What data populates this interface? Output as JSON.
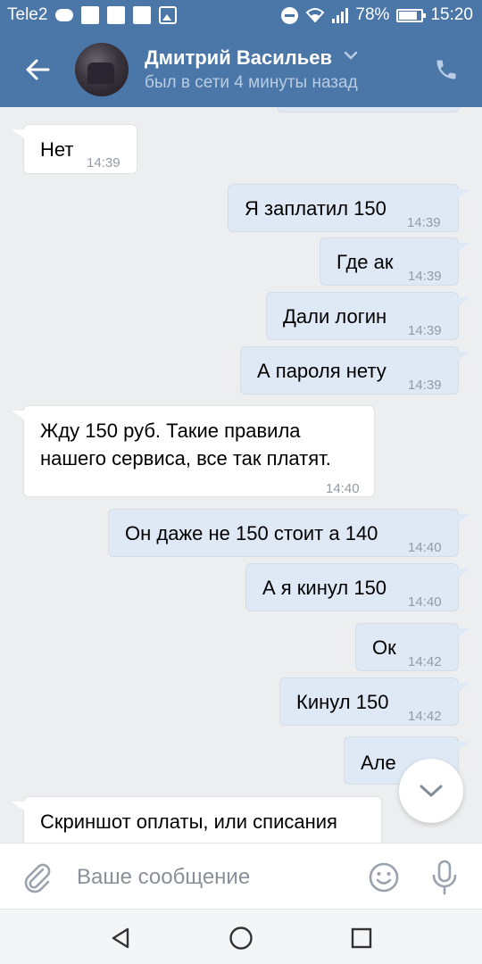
{
  "status_bar": {
    "carrier": "Tele2",
    "battery": "78%",
    "time": "15:20"
  },
  "header": {
    "back_icon": "arrow-left-icon",
    "contact_name": "Дмитрий Васильев",
    "status": "был в сети 4 минуты назад",
    "call_icon": "phone-icon"
  },
  "messages": [
    {
      "direction": "in",
      "text": "Нет",
      "time": "14:39"
    },
    {
      "direction": "out",
      "text": "Я заплатил 150",
      "time": "14:39"
    },
    {
      "direction": "out",
      "text": "Где ак",
      "time": "14:39"
    },
    {
      "direction": "out",
      "text": "Дали логин",
      "time": "14:39"
    },
    {
      "direction": "out",
      "text": "А пароля нету",
      "time": "14:39"
    },
    {
      "direction": "in",
      "text_lines": [
        "Жду 150 руб. Такие правила",
        "нашего сервиса, все так платят."
      ],
      "time": "14:40"
    },
    {
      "direction": "out",
      "text": "Он даже не 150 стоит а 140",
      "time": "14:40"
    },
    {
      "direction": "out",
      "text": "А я кинул 150",
      "time": "14:40"
    },
    {
      "direction": "out",
      "text": "Ок",
      "time": "14:42"
    },
    {
      "direction": "out",
      "text": "Кинул 150",
      "time": "14:42"
    },
    {
      "direction": "out",
      "text": "Але",
      "time": ""
    },
    {
      "direction": "in",
      "text": "Скриншот оплаты, или списания",
      "time": ""
    }
  ],
  "composer": {
    "placeholder": "Ваше сообщение"
  },
  "colors": {
    "accent": "#4a76a8",
    "outgoing_bubble": "#dfe9f5",
    "background": "#edeef0"
  }
}
